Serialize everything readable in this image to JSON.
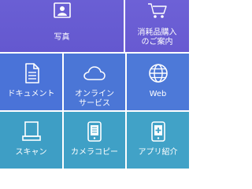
{
  "tiles": {
    "photo": {
      "label": "写真",
      "icon": "photo-icon"
    },
    "supplies": {
      "label": "消耗品購入\nのご案内",
      "icon": "shopping-cart-icon"
    },
    "document": {
      "label": "ドキュメント",
      "icon": "document-icon"
    },
    "online_service": {
      "label": "オンライン\nサービス",
      "icon": "cloud-icon"
    },
    "web": {
      "label": "Web",
      "icon": "globe-icon"
    },
    "scan": {
      "label": "スキャン",
      "icon": "scanner-icon"
    },
    "camera_copy": {
      "label": "カメラコピー",
      "icon": "camera-copy-icon"
    },
    "app_intro": {
      "label": "アプリ紹介",
      "icon": "app-plus-icon"
    }
  },
  "colors": {
    "row1": "#6a5fd4",
    "row2": "#4a73d8",
    "row3": "#3e9ec5",
    "text": "#ffffff"
  }
}
